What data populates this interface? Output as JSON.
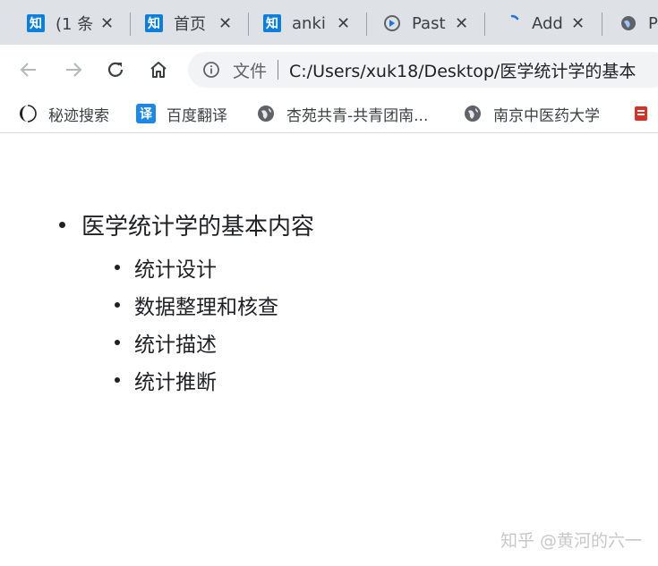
{
  "tabs": [
    {
      "title": "(1 条",
      "icon": "zhihu-icon",
      "glyph": "知"
    },
    {
      "title": "首页",
      "icon": "zhihu-icon",
      "glyph": "知"
    },
    {
      "title": "anki",
      "icon": "zhihu-icon",
      "glyph": "知"
    },
    {
      "title": "Past",
      "icon": "paste-icon"
    },
    {
      "title": "Add",
      "icon": "loading-icon"
    },
    {
      "title": "P",
      "icon": "globe-icon"
    }
  ],
  "close_glyph": "✕",
  "toolbar": {
    "scheme": "文件",
    "url": "C:/Users/xuk18/Desktop/医学统计学的基本"
  },
  "bookmarks": [
    {
      "label": "秘迹搜索",
      "icon": "mijisou-icon"
    },
    {
      "label": "百度翻译",
      "icon": "baidu-translate-icon",
      "glyph": "译"
    },
    {
      "label": "杏苑共青-共青团南...",
      "icon": "globe-icon"
    },
    {
      "label": "南京中医药大学",
      "icon": "globe-icon"
    }
  ],
  "outline": {
    "heading": "医学统计学的基本内容",
    "items": [
      "统计设计",
      "数据整理和核查",
      "统计描述",
      "统计推断"
    ]
  },
  "watermark": "知乎 @黄河的六一",
  "colors": {
    "tabbar": "#dee1e6",
    "zhihu_blue": "#0b7fd9",
    "omnibox": "#f1f3f4"
  }
}
